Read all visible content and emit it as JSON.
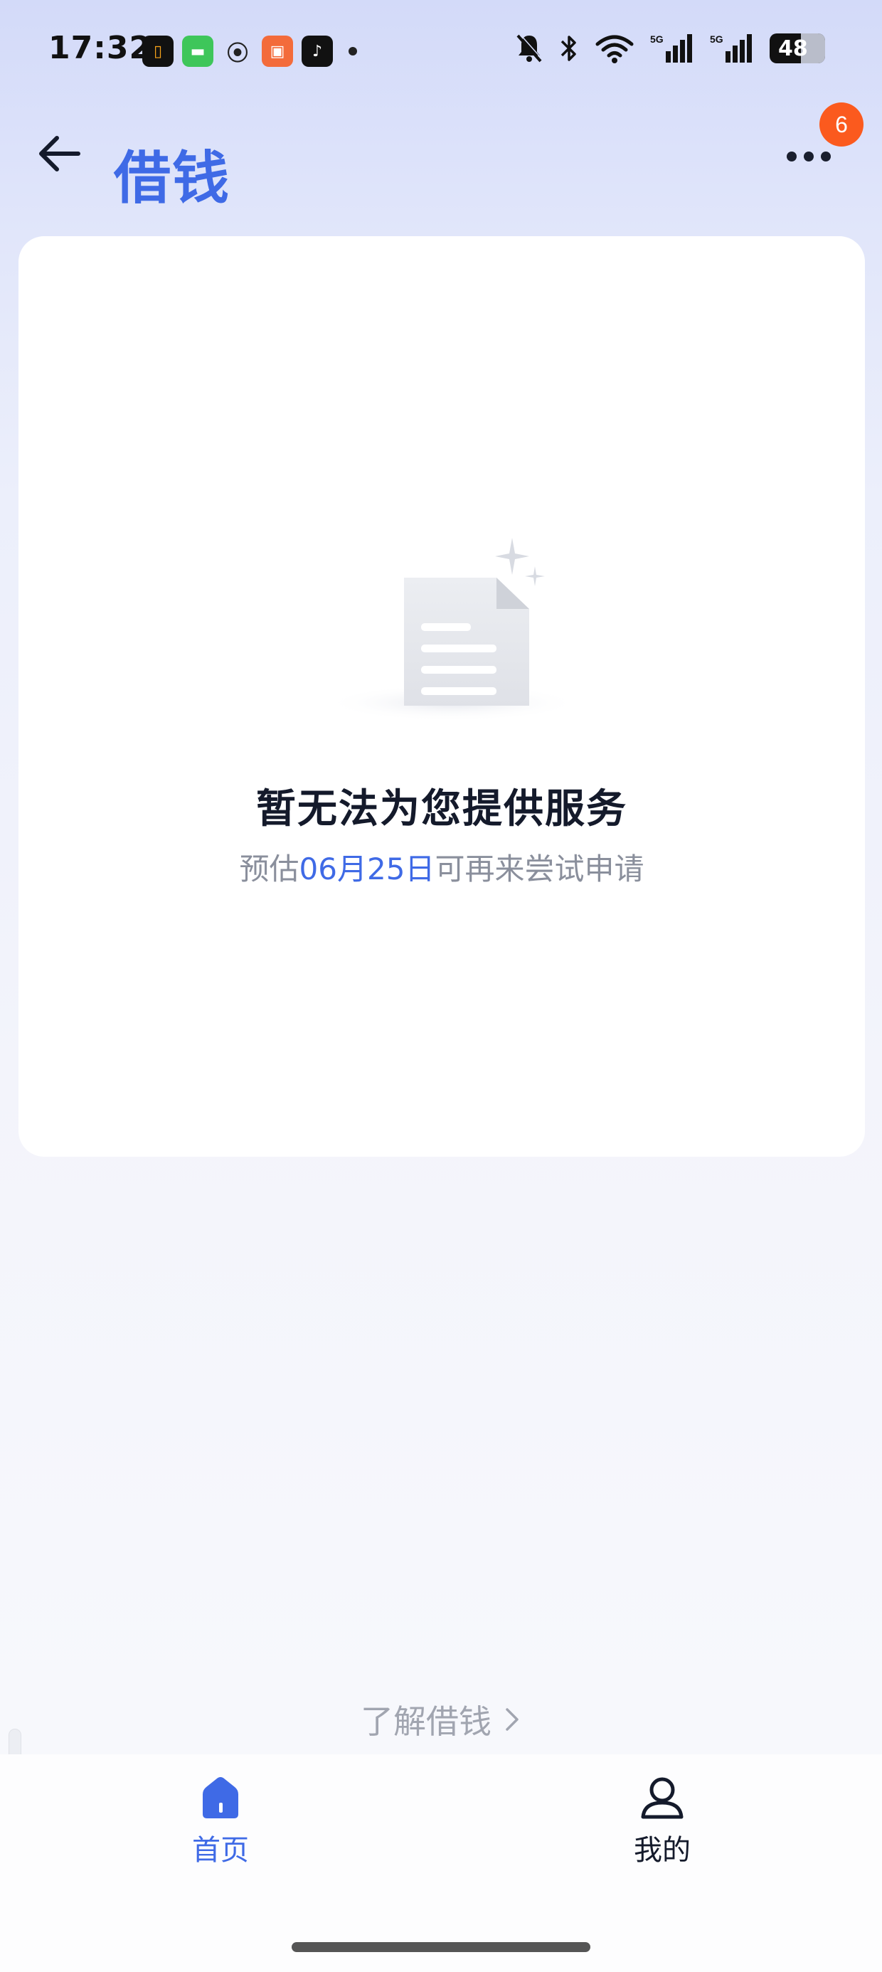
{
  "status_bar": {
    "time": "17:32",
    "notification_icons": [
      "app-icon-orange",
      "messages-icon",
      "hotspot-icon",
      "app-icon-red",
      "tiktok-icon"
    ],
    "system_icons": [
      "mute-icon",
      "bluetooth-icon",
      "wifi-icon",
      "5g-signal-icon",
      "5g-signal-icon"
    ],
    "battery": "48",
    "signal_label": "5G"
  },
  "header": {
    "title": "借钱",
    "badge_count": "6"
  },
  "card": {
    "empty_title": "暂无法为您提供服务",
    "subtitle_prefix": "预估",
    "subtitle_date": "06月25日",
    "subtitle_suffix": "可再来尝试申请"
  },
  "learn_link": "了解借钱",
  "bottom_nav": {
    "items": [
      {
        "label": "首页",
        "icon": "home-icon",
        "active": true
      },
      {
        "label": "我的",
        "icon": "user-icon",
        "active": false
      }
    ]
  },
  "colors": {
    "accent": "#3f6ae6",
    "badge": "#fb5a1e"
  }
}
